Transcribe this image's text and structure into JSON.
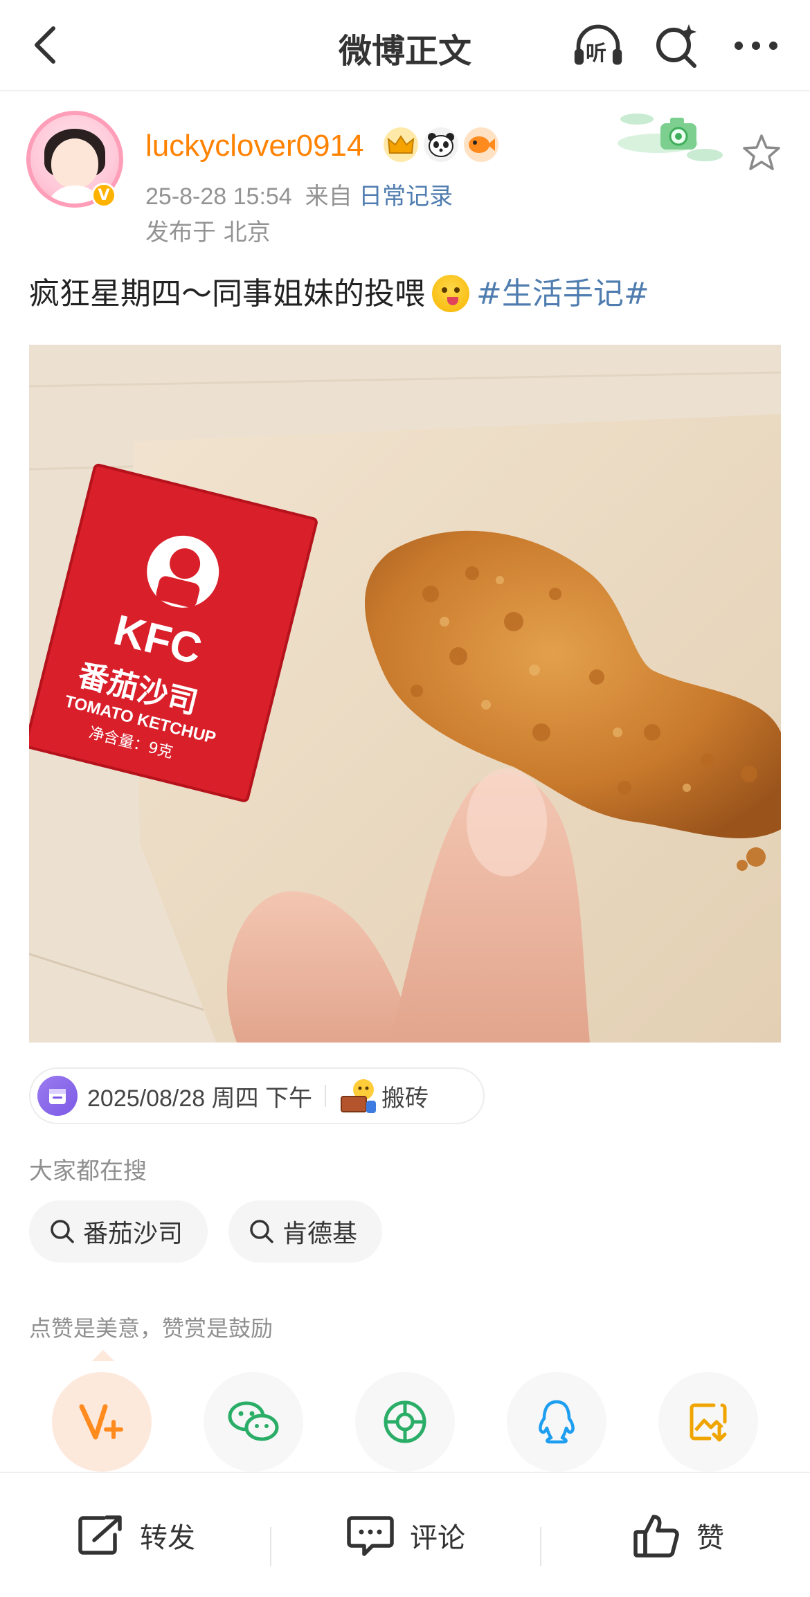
{
  "header": {
    "title": "微博正文",
    "listen_label": "听"
  },
  "author": {
    "name": "luckyclover0914",
    "time": "25-8-28 15:54",
    "source_prefix": "来自",
    "source": "日常记录",
    "location": "发布于 北京"
  },
  "post": {
    "text": "疯狂星期四～同事姐妹的投喂",
    "topic": "#生活手记#"
  },
  "photo": {
    "packet_brand": "KFC",
    "packet_cn": "番茄沙司",
    "packet_en": "TOMATO KETCHUP",
    "packet_net": "净含量：9克"
  },
  "mood_chip": {
    "date": "2025/08/28 周四 下午",
    "mood": "搬砖"
  },
  "hot_search": {
    "title": "大家都在搜",
    "items": [
      "番茄沙司",
      "肯德基"
    ]
  },
  "share_section": {
    "title": "点赞是美意，赞赏是鼓励",
    "targets": [
      "v-plus-icon",
      "wechat-icon",
      "moments-icon",
      "qq-icon",
      "save-image-icon"
    ]
  },
  "actions": {
    "repost": "转发",
    "comment": "评论",
    "like": "赞"
  },
  "colors": {
    "username": "#ff8200",
    "link": "#507daf",
    "meta": "#939393"
  }
}
